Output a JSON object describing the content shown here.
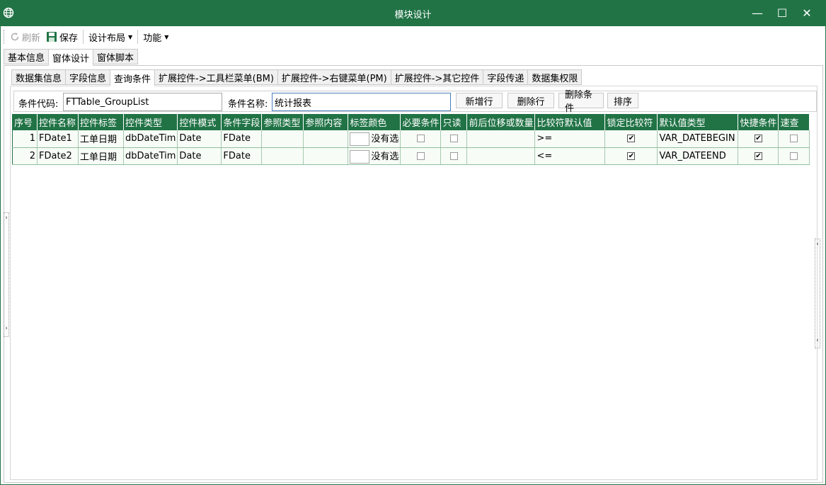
{
  "window": {
    "title": "模块设计",
    "minimize": "—",
    "maximize": "☐",
    "close": "✕"
  },
  "toolbar": {
    "refresh_label": "刷新",
    "save_label": "保存",
    "layout_label": "设计布局",
    "function_label": "功能"
  },
  "main_tabs": [
    "基本信息",
    "窗体设计",
    "窗体脚本"
  ],
  "sub_tabs": [
    "数据集信息",
    "字段信息",
    "查询条件",
    "扩展控件->工具栏菜单(BM)",
    "扩展控件->右键菜单(PM)",
    "扩展控件->其它控件",
    "字段传递",
    "数据集权限"
  ],
  "filter": {
    "code_label": "条件代码:",
    "code_value": "FTTable_GroupList",
    "name_label": "条件名称:",
    "name_value": "统计报表",
    "add_row": "新增行",
    "delete_row": "删除行",
    "delete_condition": "删除条件",
    "sort": "排序"
  },
  "grid": {
    "columns": [
      "序号",
      "控件名称",
      "控件标签",
      "控件类型",
      "控件模式",
      "条件字段",
      "参照类型",
      "参照内容",
      "标签颜色",
      "必要条件",
      "只读",
      "前后位移或数量",
      "比较符默认值",
      "锁定比较符",
      "默认值类型",
      "快捷条件",
      "速查"
    ],
    "rows": [
      {
        "no": "1",
        "name": "FDate1",
        "label": "工单日期",
        "type": "dbDateTim",
        "mode": "Date",
        "field": "FDate",
        "ref_type": "",
        "ref_content": "",
        "color_text": "没有选",
        "required": false,
        "readonly": false,
        "offset": "",
        "compare": ">=",
        "lock_compare": true,
        "default_type": "VAR_DATEBEGIN",
        "quick": true,
        "lookup": false
      },
      {
        "no": "2",
        "name": "FDate2",
        "label": "工单日期",
        "type": "dbDateTim",
        "mode": "Date",
        "field": "FDate",
        "ref_type": "",
        "ref_content": "",
        "color_text": "没有选",
        "required": false,
        "readonly": false,
        "offset": "",
        "compare": "<=",
        "lock_compare": true,
        "default_type": "VAR_DATEEND",
        "quick": true,
        "lookup": false
      }
    ]
  },
  "check_mark": "✔"
}
